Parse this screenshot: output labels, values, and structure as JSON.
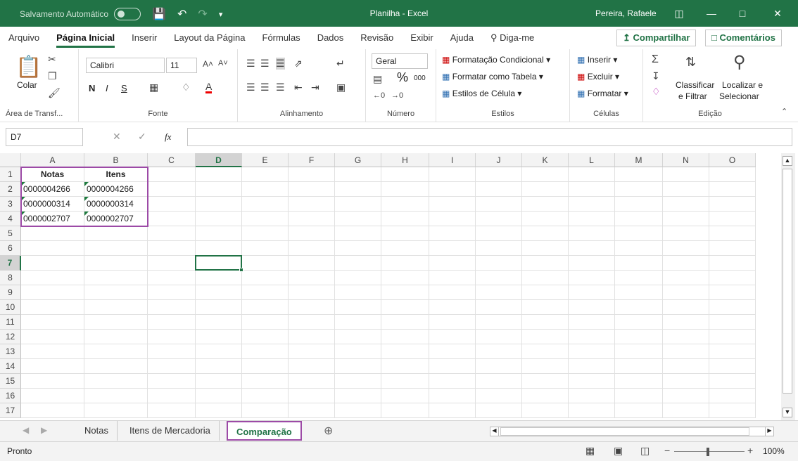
{
  "titlebar": {
    "autosave_label": "Salvamento Automático",
    "autosave_state": "Desativado",
    "title": "Planilha - Excel",
    "user": "Pereira, Rafaele"
  },
  "ribbon_tabs": [
    "Arquivo",
    "Página Inicial",
    "Inserir",
    "Layout da Página",
    "Fórmulas",
    "Dados",
    "Revisão",
    "Exibir",
    "Ajuda",
    "Diga-me"
  ],
  "share_label": "Compartilhar",
  "comments_label": "Comentários",
  "ribbon": {
    "clipboard": {
      "paste": "Colar",
      "label": "Área de Transf..."
    },
    "font": {
      "name": "Calibri",
      "size": "11",
      "label": "Fonte",
      "bold": "N",
      "italic": "I",
      "underline": "S"
    },
    "alignment": {
      "label": "Alinhamento"
    },
    "number": {
      "format": "Geral",
      "label": "Número",
      "percent": "%",
      "thousands": "000"
    },
    "styles": {
      "conditional": "Formatação Condicional",
      "table": "Formatar como Tabela",
      "cell": "Estilos de Célula",
      "label": "Estilos"
    },
    "cells": {
      "insert": "Inserir",
      "delete": "Excluir",
      "format": "Formatar",
      "label": "Células"
    },
    "editing": {
      "sort_line1": "Classificar",
      "sort_line2": "e Filtrar",
      "find_line1": "Localizar e",
      "find_line2": "Selecionar",
      "label": "Edição"
    }
  },
  "formula_bar": {
    "name_box": "D7",
    "fx": "fx",
    "value": ""
  },
  "columns": [
    "A",
    "B",
    "C",
    "D",
    "E",
    "F",
    "G",
    "H",
    "I",
    "J",
    "K",
    "L",
    "M",
    "N",
    "O"
  ],
  "rows": [
    "1",
    "2",
    "3",
    "4",
    "5",
    "6",
    "7",
    "8",
    "9",
    "10",
    "11",
    "12",
    "13",
    "14",
    "15",
    "16",
    "17"
  ],
  "cells": {
    "A1": "Notas",
    "B1": "Itens",
    "A2": "0000004266",
    "B2": "0000004266",
    "A3": "0000000314",
    "B3": "0000000314",
    "A4": "0000002707",
    "B4": "0000002707"
  },
  "selected_cell": "D7",
  "sheet_tabs": [
    "Notas",
    "Itens de Mercadoria",
    "Comparação"
  ],
  "active_sheet": "Comparação",
  "status": {
    "ready": "Pronto",
    "zoom": "100%"
  },
  "colors": {
    "accent": "#217346",
    "highlight": "#9c4aa6"
  }
}
